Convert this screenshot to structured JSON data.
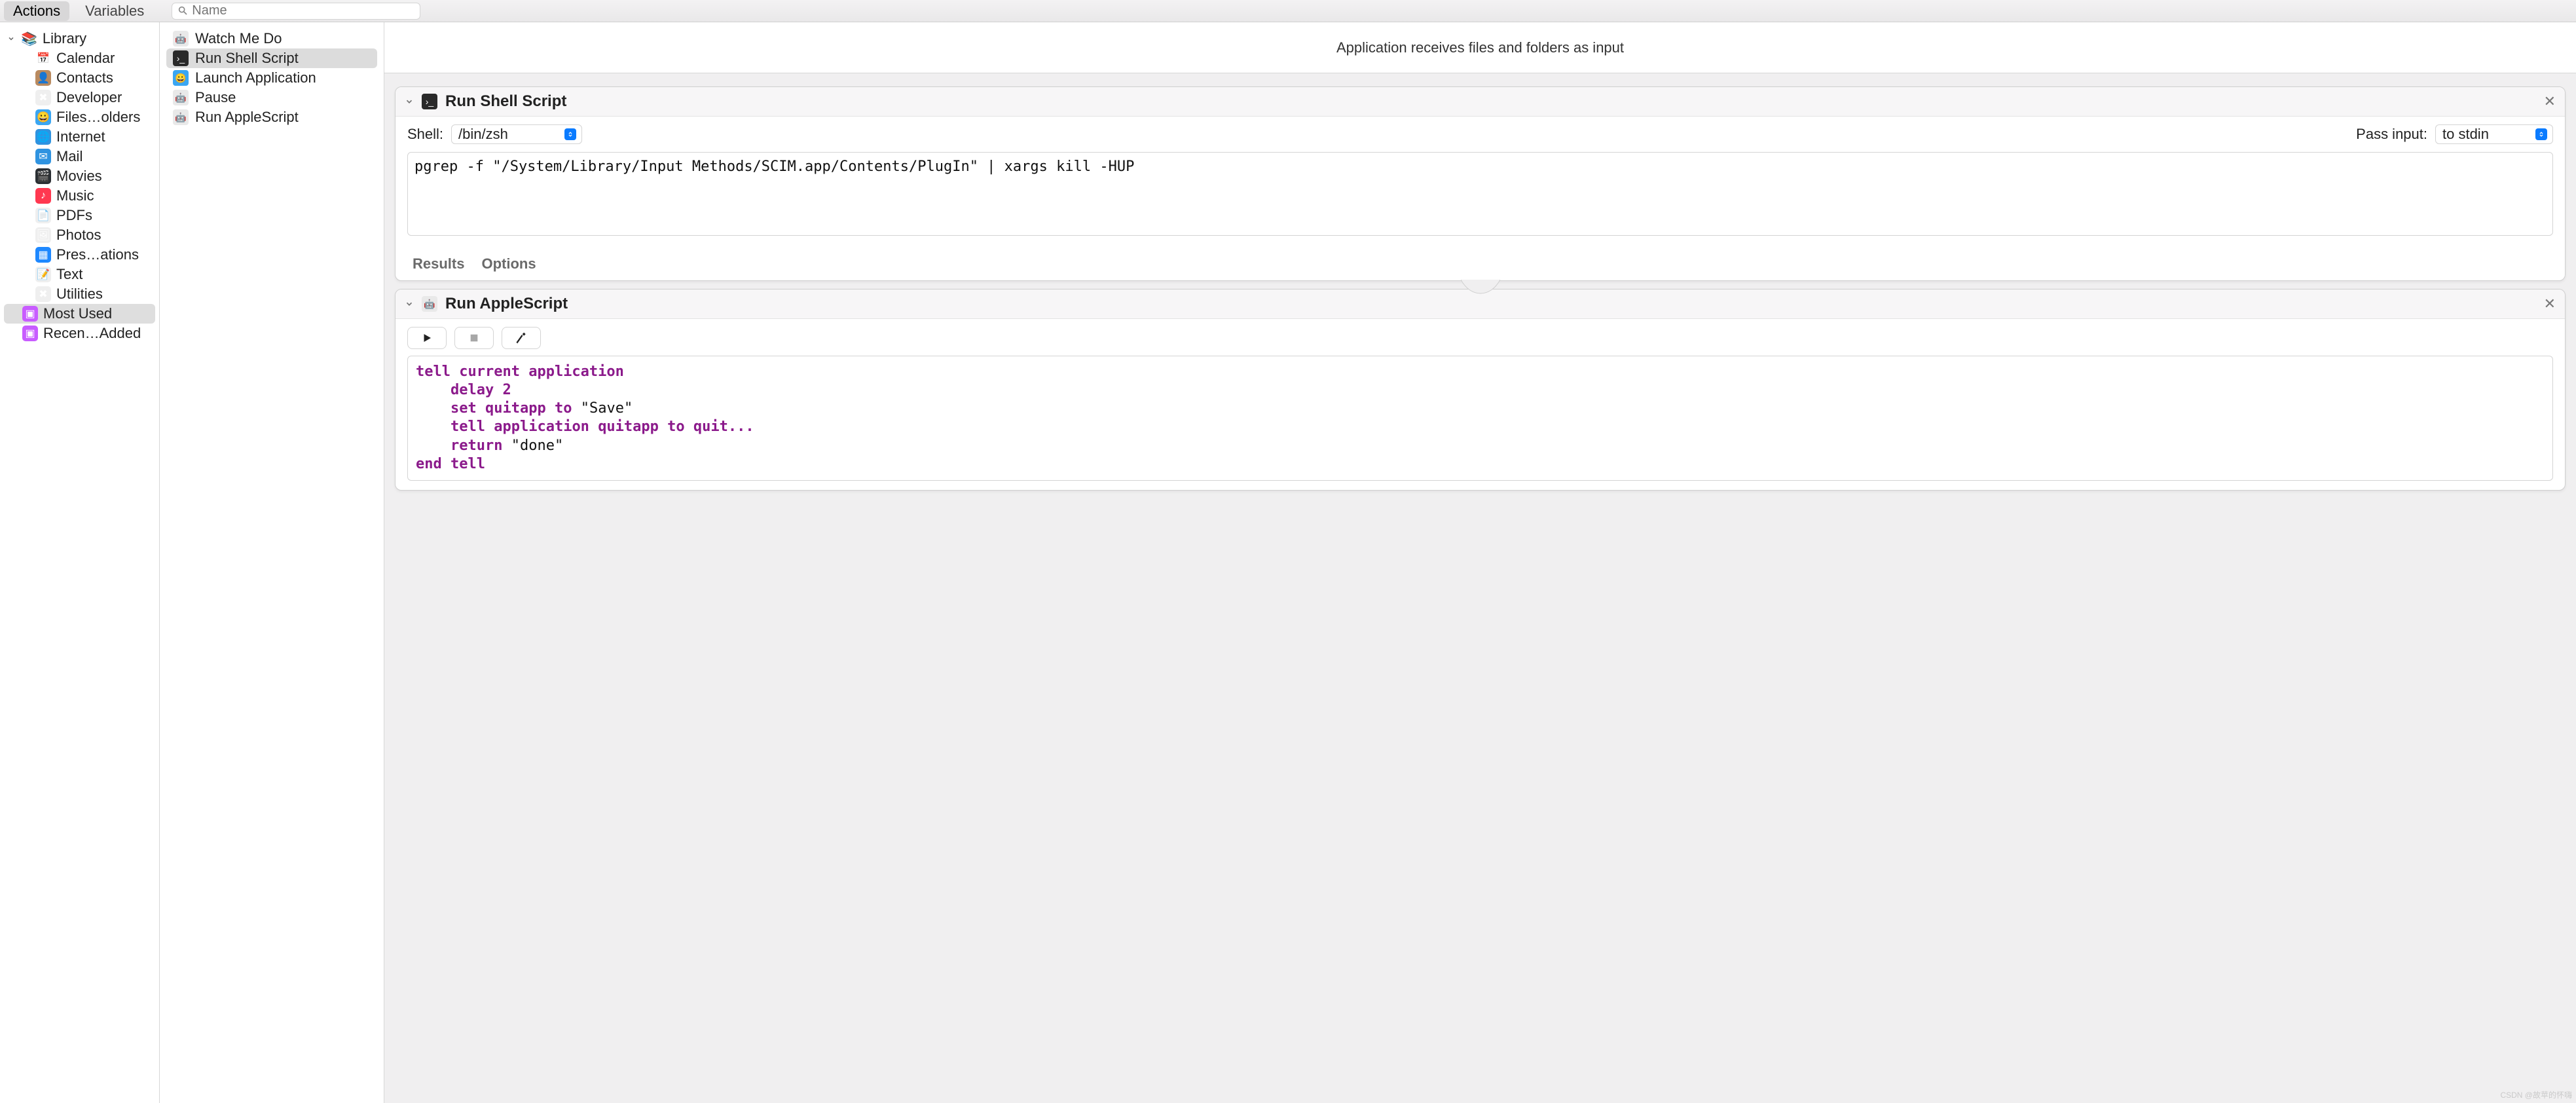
{
  "toolbar": {
    "tabs": {
      "actions": "Actions",
      "variables": "Variables"
    },
    "search_placeholder": "Name"
  },
  "sidebar": {
    "library_label": "Library",
    "items": [
      {
        "label": "Calendar",
        "bg": "#ffffff",
        "emoji": "📅"
      },
      {
        "label": "Contacts",
        "bg": "#b98a5f",
        "emoji": "👤"
      },
      {
        "label": "Developer",
        "bg": "#efefef",
        "emoji": "✖"
      },
      {
        "label": "Files…olders",
        "bg": "#3aa6f2",
        "emoji": "😀"
      },
      {
        "label": "Internet",
        "bg": "#2f93e0",
        "emoji": "🌐"
      },
      {
        "label": "Mail",
        "bg": "#2f93e0",
        "emoji": "✉"
      },
      {
        "label": "Movies",
        "bg": "#2b2f33",
        "emoji": "🎬"
      },
      {
        "label": "Music",
        "bg": "#ff3850",
        "emoji": "♪"
      },
      {
        "label": "PDFs",
        "bg": "#efefef",
        "emoji": "📄"
      },
      {
        "label": "Photos",
        "bg": "#efefef",
        "emoji": "🖼"
      },
      {
        "label": "Pres…ations",
        "bg": "#1e88ff",
        "emoji": "▦"
      },
      {
        "label": "Text",
        "bg": "#efefef",
        "emoji": "📝"
      },
      {
        "label": "Utilities",
        "bg": "#efefef",
        "emoji": "✖"
      }
    ],
    "most_used": "Most Used",
    "recently_added": "Recen…Added"
  },
  "actions_list": [
    {
      "label": "Watch Me Do",
      "icon": "automator"
    },
    {
      "label": "Run Shell Script",
      "icon": "terminal",
      "selected": true
    },
    {
      "label": "Launch Application",
      "icon": "finder"
    },
    {
      "label": "Pause",
      "icon": "automator"
    },
    {
      "label": "Run AppleScript",
      "icon": "automator"
    }
  ],
  "workspace": {
    "header": "Application receives files and folders as input",
    "shell_step": {
      "title": "Run Shell Script",
      "shell_label": "Shell:",
      "shell_value": "/bin/zsh",
      "pass_label": "Pass input:",
      "pass_value": "to stdin",
      "code": "pgrep -f \"/System/Library/Input Methods/SCIM.app/Contents/PlugIn\" | xargs kill -HUP",
      "results": "Results",
      "options": "Options"
    },
    "as_step": {
      "title": "Run AppleScript",
      "code_lines": [
        "tell current application",
        "    delay 2",
        "    set quitapp to \"Save\"",
        "    tell application quitapp to quit...",
        "    return \"done\"",
        "end tell"
      ]
    }
  },
  "watermark": "CSDN @故苹的怀嗨"
}
